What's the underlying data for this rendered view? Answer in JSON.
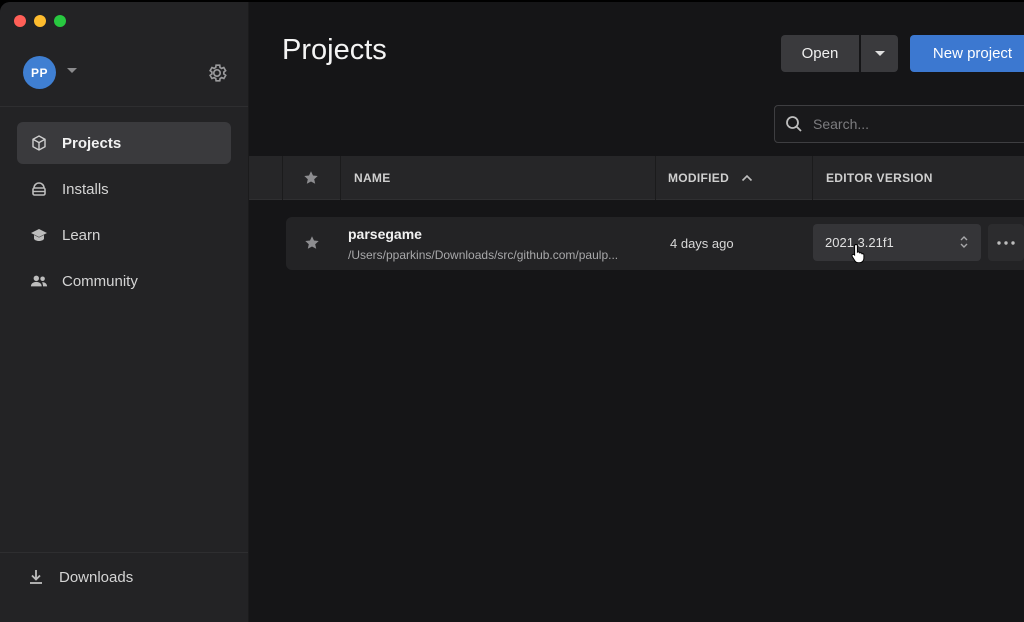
{
  "window": {
    "traffic_lights": [
      "close",
      "minimize",
      "zoom"
    ]
  },
  "sidebar": {
    "avatar_initials": "PP",
    "items": [
      {
        "label": "Projects",
        "icon": "cube-icon",
        "active": true
      },
      {
        "label": "Installs",
        "icon": "installs-icon",
        "active": false
      },
      {
        "label": "Learn",
        "icon": "graduation-cap-icon",
        "active": false
      },
      {
        "label": "Community",
        "icon": "people-icon",
        "active": false
      }
    ],
    "downloads_label": "Downloads"
  },
  "header": {
    "title": "Projects",
    "open_label": "Open",
    "new_project_label": "New project"
  },
  "search": {
    "placeholder": "Search..."
  },
  "table": {
    "columns": {
      "name": "NAME",
      "modified": "MODIFIED",
      "editor_version": "EDITOR VERSION"
    },
    "sort": {
      "column": "modified",
      "direction": "ascending"
    },
    "rows": [
      {
        "name": "parsegame",
        "path": "/Users/pparkins/Downloads/src/github.com/paulp...",
        "modified": "4 days ago",
        "editor_version": "2021.3.21f1",
        "starred": false
      }
    ]
  },
  "colors": {
    "accent": "#3c78d0",
    "avatar": "#3f7fd2",
    "sidebar_bg": "#232325",
    "main_bg": "#151517"
  }
}
